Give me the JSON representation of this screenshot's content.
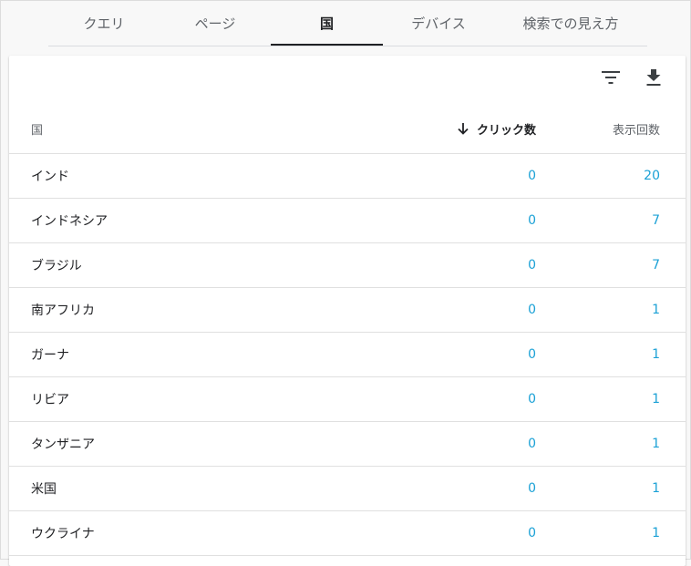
{
  "tabs": [
    {
      "label": "クエリ",
      "active": false
    },
    {
      "label": "ページ",
      "active": false
    },
    {
      "label": "国",
      "active": true
    },
    {
      "label": "デバイス",
      "active": false
    },
    {
      "label": "検索での見え方",
      "active": false
    }
  ],
  "toolbar": {
    "filter_icon": "filter-icon",
    "download_icon": "download-icon"
  },
  "table": {
    "columns": {
      "country": "国",
      "clicks": "クリック数",
      "impressions": "表示回数"
    },
    "sort_icon": "arrow-down-icon",
    "rows": [
      {
        "country": "インド",
        "clicks": "0",
        "impressions": "20"
      },
      {
        "country": "インドネシア",
        "clicks": "0",
        "impressions": "7"
      },
      {
        "country": "ブラジル",
        "clicks": "0",
        "impressions": "7"
      },
      {
        "country": "南アフリカ",
        "clicks": "0",
        "impressions": "1"
      },
      {
        "country": "ガーナ",
        "clicks": "0",
        "impressions": "1"
      },
      {
        "country": "リビア",
        "clicks": "0",
        "impressions": "1"
      },
      {
        "country": "タンザニア",
        "clicks": "0",
        "impressions": "1"
      },
      {
        "country": "米国",
        "clicks": "0",
        "impressions": "1"
      },
      {
        "country": "ウクライナ",
        "clicks": "0",
        "impressions": "1"
      }
    ]
  },
  "colors": {
    "link_number": "#1ba1d6",
    "active_tab_underline": "#202124"
  }
}
